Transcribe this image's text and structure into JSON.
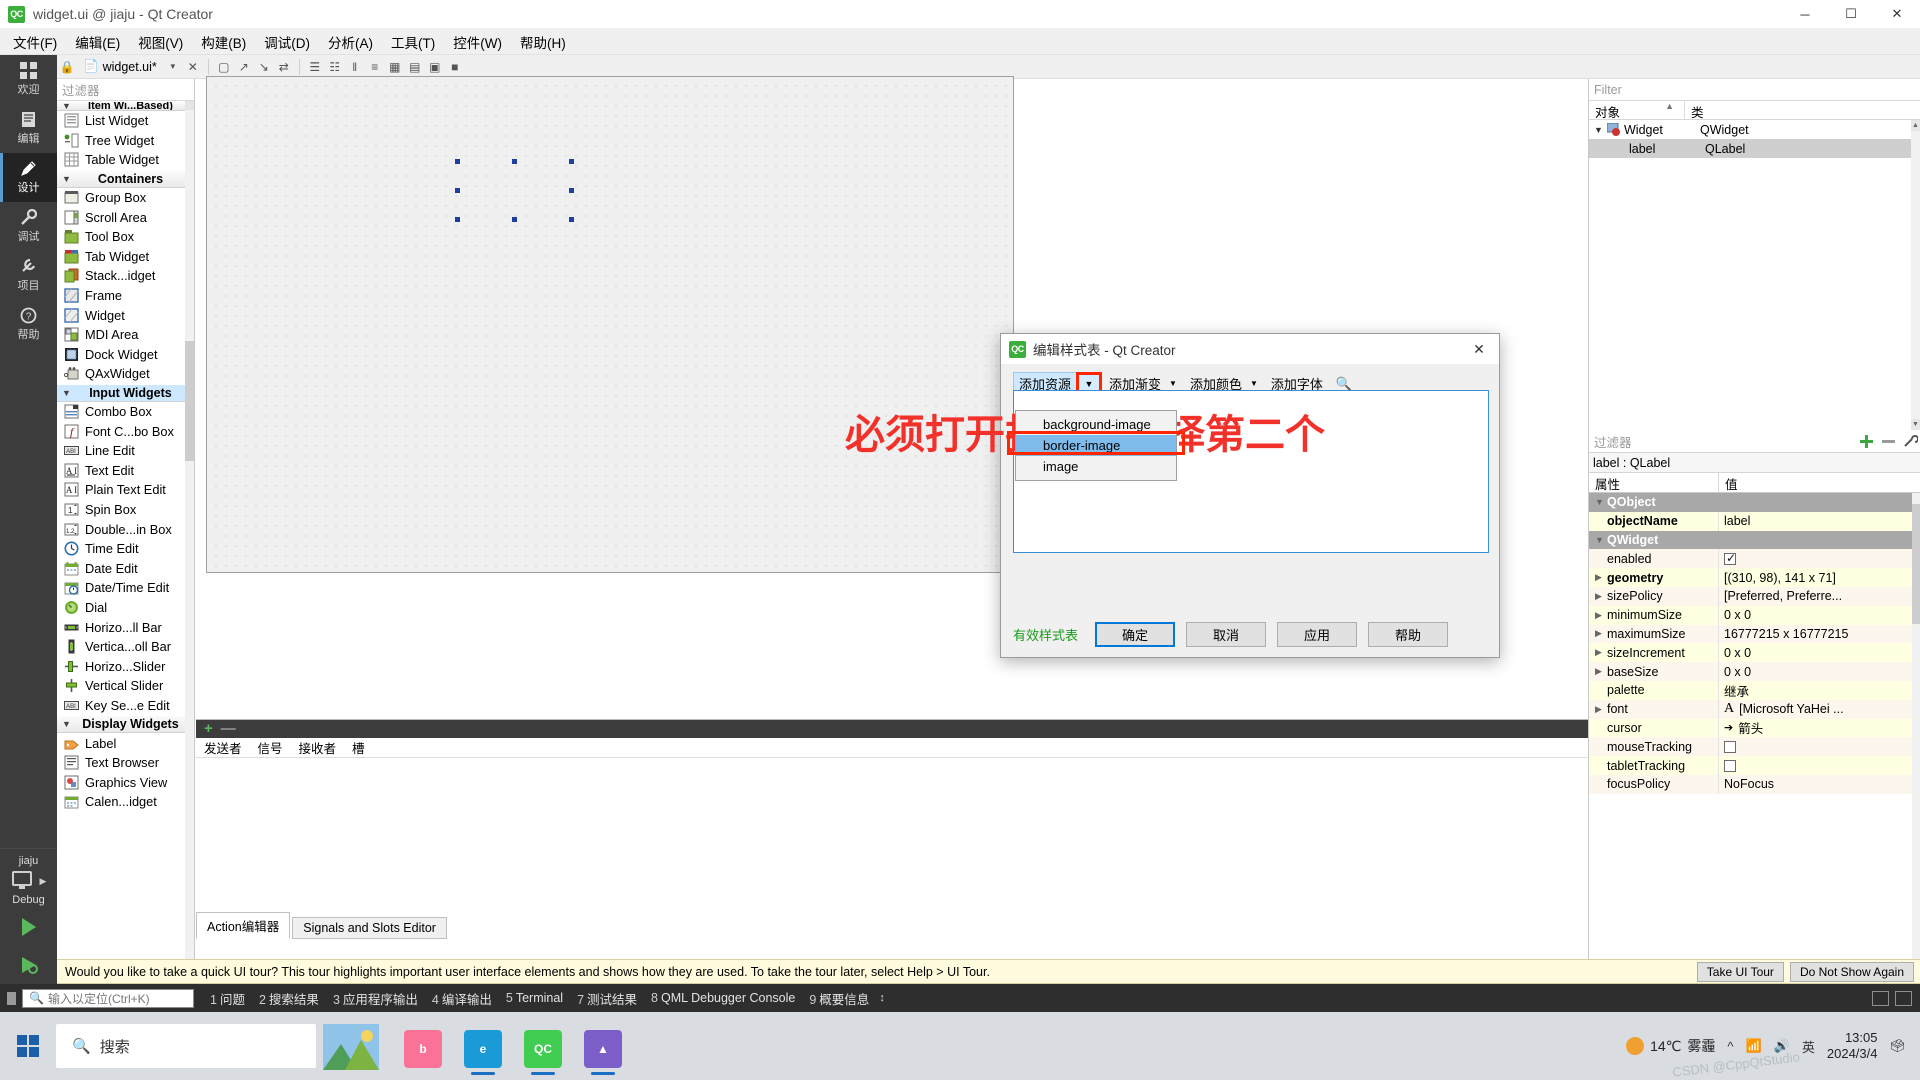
{
  "window": {
    "title": "widget.ui @ jiaju - Qt Creator",
    "logo": "QC",
    "minimize": "─",
    "maximize": "☐",
    "close": "✕"
  },
  "menubar": {
    "items": [
      {
        "label": "文件(F)",
        "name": "menu-file"
      },
      {
        "label": "编辑(E)",
        "name": "menu-edit"
      },
      {
        "label": "视图(V)",
        "name": "menu-view"
      },
      {
        "label": "构建(B)",
        "name": "menu-build"
      },
      {
        "label": "调试(D)",
        "name": "menu-debug"
      },
      {
        "label": "分析(A)",
        "name": "menu-analyze"
      },
      {
        "label": "工具(T)",
        "name": "menu-tools"
      },
      {
        "label": "控件(W)",
        "name": "menu-widgets"
      },
      {
        "label": "帮助(H)",
        "name": "menu-help"
      }
    ]
  },
  "modebar": {
    "items": [
      {
        "label": "欢迎",
        "icon": "grid-icon",
        "active": false
      },
      {
        "label": "编辑",
        "icon": "document-icon",
        "active": false
      },
      {
        "label": "设计",
        "icon": "pencil-icon",
        "active": true
      },
      {
        "label": "调试",
        "icon": "wrench-icon",
        "active": false
      },
      {
        "label": "项目",
        "icon": "spanner-icon",
        "active": false
      },
      {
        "label": "帮助",
        "icon": "help-icon",
        "active": false
      }
    ],
    "kit_name": "jiaju",
    "kit_sub": "Debug"
  },
  "editor_toolbar": {
    "filename": "widget.ui*",
    "close_label": "✕",
    "dropdown_label": "▼"
  },
  "widget_box": {
    "filter_placeholder": "过滤器",
    "groups": [
      {
        "name": "Item Wi...Based)",
        "header": "Item Wi...Based)",
        "partial": true,
        "items": [
          {
            "label": "List Widget",
            "icon": "list-widget-icon"
          },
          {
            "label": "Tree Widget",
            "icon": "tree-widget-icon"
          },
          {
            "label": "Table Widget",
            "icon": "table-widget-icon"
          }
        ]
      },
      {
        "name": "Containers",
        "header": "Containers",
        "items": [
          {
            "label": "Group Box",
            "icon": "group-box-icon"
          },
          {
            "label": "Scroll Area",
            "icon": "scroll-area-icon"
          },
          {
            "label": "Tool Box",
            "icon": "tool-box-icon"
          },
          {
            "label": "Tab Widget",
            "icon": "tab-widget-icon"
          },
          {
            "label": "Stack...idget",
            "icon": "stacked-widget-icon"
          },
          {
            "label": "Frame",
            "icon": "frame-icon"
          },
          {
            "label": "Widget",
            "icon": "widget-icon"
          },
          {
            "label": "MDI Area",
            "icon": "mdi-area-icon"
          },
          {
            "label": "Dock Widget",
            "icon": "dock-widget-icon"
          },
          {
            "label": "QAxWidget",
            "icon": "qax-widget-icon"
          }
        ]
      },
      {
        "name": "Input Widgets",
        "header": "Input Widgets",
        "selected": true,
        "items": [
          {
            "label": "Combo Box",
            "icon": "combo-box-icon"
          },
          {
            "label": "Font C...bo Box",
            "icon": "font-combo-box-icon"
          },
          {
            "label": "Line Edit",
            "icon": "line-edit-icon"
          },
          {
            "label": "Text Edit",
            "icon": "text-edit-icon"
          },
          {
            "label": "Plain Text Edit",
            "icon": "plain-text-edit-icon"
          },
          {
            "label": "Spin Box",
            "icon": "spin-box-icon"
          },
          {
            "label": "Double...in Box",
            "icon": "double-spin-box-icon"
          },
          {
            "label": "Time Edit",
            "icon": "time-edit-icon"
          },
          {
            "label": "Date Edit",
            "icon": "date-edit-icon"
          },
          {
            "label": "Date/Time Edit",
            "icon": "date-time-edit-icon"
          },
          {
            "label": "Dial",
            "icon": "dial-icon"
          },
          {
            "label": "Horizo...ll Bar",
            "icon": "horizontal-scroll-bar-icon"
          },
          {
            "label": "Vertica...oll Bar",
            "icon": "vertical-scroll-bar-icon"
          },
          {
            "label": "Horizo...Slider",
            "icon": "horizontal-slider-icon"
          },
          {
            "label": "Vertical Slider",
            "icon": "vertical-slider-icon"
          },
          {
            "label": "Key Se...e Edit",
            "icon": "key-sequence-edit-icon"
          }
        ]
      },
      {
        "name": "Display Widgets",
        "header": "Display Widgets",
        "items": [
          {
            "label": "Label",
            "icon": "label-icon"
          },
          {
            "label": "Text Browser",
            "icon": "text-browser-icon"
          },
          {
            "label": "Graphics View",
            "icon": "graphics-view-icon"
          },
          {
            "label": "Calen...idget",
            "icon": "calendar-widget-icon"
          }
        ]
      }
    ]
  },
  "signals_slots": {
    "headers": [
      "发送者",
      "信号",
      "接收者",
      "槽"
    ],
    "tabs": [
      {
        "label": "Action编辑器",
        "active": true
      },
      {
        "label": "Signals and Slots Editor",
        "active": false
      }
    ],
    "add": "+",
    "remove": "—"
  },
  "object_inspector": {
    "filter_placeholder": "Filter",
    "columns": [
      "对象",
      "类"
    ],
    "rows": [
      {
        "name": "Widget",
        "class": "QWidget",
        "level": 0,
        "expanded": true,
        "selected": false
      },
      {
        "name": "label",
        "class": "QLabel",
        "level": 1,
        "expanded": false,
        "selected": true
      }
    ]
  },
  "property_editor": {
    "filter_placeholder": "过滤器",
    "object_line": "label : QLabel",
    "columns": [
      "属性",
      "值"
    ],
    "add_icon": "plus-icon",
    "remove_icon": "minus-icon",
    "config_icon": "wrench-icon",
    "rows": [
      {
        "key": "QObject",
        "value": "",
        "type": "group"
      },
      {
        "key": "objectName",
        "value": "label",
        "type": "prop",
        "bold": true
      },
      {
        "key": "QWidget",
        "value": "",
        "type": "group"
      },
      {
        "key": "enabled",
        "value": "",
        "type": "check",
        "checked": true
      },
      {
        "key": "geometry",
        "value": "[(310, 98), 141 x 71]",
        "type": "prop",
        "expandable": true,
        "bold": true
      },
      {
        "key": "sizePolicy",
        "value": "[Preferred, Preferre...",
        "type": "prop",
        "expandable": true
      },
      {
        "key": "minimumSize",
        "value": "0 x 0",
        "type": "prop",
        "expandable": true
      },
      {
        "key": "maximumSize",
        "value": "16777215 x 16777215",
        "type": "prop",
        "expandable": true
      },
      {
        "key": "sizeIncrement",
        "value": "0 x 0",
        "type": "prop",
        "expandable": true
      },
      {
        "key": "baseSize",
        "value": "0 x 0",
        "type": "prop",
        "expandable": true
      },
      {
        "key": "palette",
        "value": "继承",
        "type": "prop"
      },
      {
        "key": "font",
        "value": "[Microsoft YaHei ...",
        "type": "font",
        "expandable": true
      },
      {
        "key": "cursor",
        "value": "箭头",
        "type": "cursor"
      },
      {
        "key": "mouseTracking",
        "value": "",
        "type": "check",
        "checked": false
      },
      {
        "key": "tabletTracking",
        "value": "",
        "type": "check",
        "checked": false
      },
      {
        "key": "focusPolicy",
        "value": "NoFocus",
        "type": "prop"
      }
    ]
  },
  "dialog": {
    "title": "编辑样式表 - Qt Creator",
    "logo": "QC",
    "close": "✕",
    "toolbar": [
      {
        "label": "添加资源",
        "name": "add-resource-button",
        "highlight": true
      },
      {
        "label": "添加渐变",
        "name": "add-gradient-button"
      },
      {
        "label": "添加颜色",
        "name": "add-color-button"
      },
      {
        "label": "添加字体",
        "name": "add-font-button"
      }
    ],
    "lens_icon": "magnifier-icon",
    "dropdown_items": [
      {
        "label": "background-image",
        "selected": false
      },
      {
        "label": "border-image",
        "selected": true,
        "highlighted": true
      },
      {
        "label": "image",
        "selected": false
      }
    ],
    "editor_text": "",
    "annotation": "必须打开折叠，选择第二个",
    "annotation_color": "#f2312b",
    "valid_text": "有效样式表",
    "valid_color": "#1a9b1a",
    "buttons": [
      {
        "label": "确定",
        "name": "ok-button",
        "primary": true
      },
      {
        "label": "取消",
        "name": "cancel-button"
      },
      {
        "label": "应用",
        "name": "apply-button"
      },
      {
        "label": "帮助",
        "name": "help-button"
      }
    ]
  },
  "tour_banner": {
    "text": "Would you like to take a quick UI tour? This tour highlights important user interface elements and shows how they are used. To take the tour later, select Help > UI Tour.",
    "buttons": [
      {
        "label": "Take UI Tour",
        "name": "take-ui-tour-button"
      },
      {
        "label": "Do Not Show Again",
        "name": "do-not-show-again-button"
      }
    ]
  },
  "statusbar": {
    "locator_placeholder": "输入以定位(Ctrl+K)",
    "search_icon": "search-icon",
    "items": [
      {
        "num": "1",
        "label": "问题"
      },
      {
        "num": "2",
        "label": "搜索结果"
      },
      {
        "num": "3",
        "label": "应用程序输出"
      },
      {
        "num": "4",
        "label": "编译输出"
      },
      {
        "num": "5",
        "label": "Terminal"
      },
      {
        "num": "7",
        "label": "测试结果"
      },
      {
        "num": "8",
        "label": "QML Debugger Console"
      },
      {
        "num": "9",
        "label": "概要信息"
      }
    ],
    "updown": "↕"
  },
  "taskbar": {
    "search_placeholder": "搜索",
    "search_icon": "search-icon",
    "apps": [
      {
        "name": "bilibili-app",
        "label": "b",
        "color": "#fb7299",
        "open": false
      },
      {
        "name": "edge-app",
        "label": "e",
        "color": "#1a9bd7",
        "open": true
      },
      {
        "name": "qt-creator-app",
        "label": "QC",
        "color": "#41cd52",
        "open": true
      },
      {
        "name": "app-4",
        "label": "▲",
        "color": "#7b5ec7",
        "open": true
      }
    ],
    "weather_temp": "14℃",
    "weather_desc": "雾霾",
    "lang": "英",
    "time": "13:05",
    "date": "2024/3/4",
    "watermark": "CSDN @CppQtStudio"
  }
}
